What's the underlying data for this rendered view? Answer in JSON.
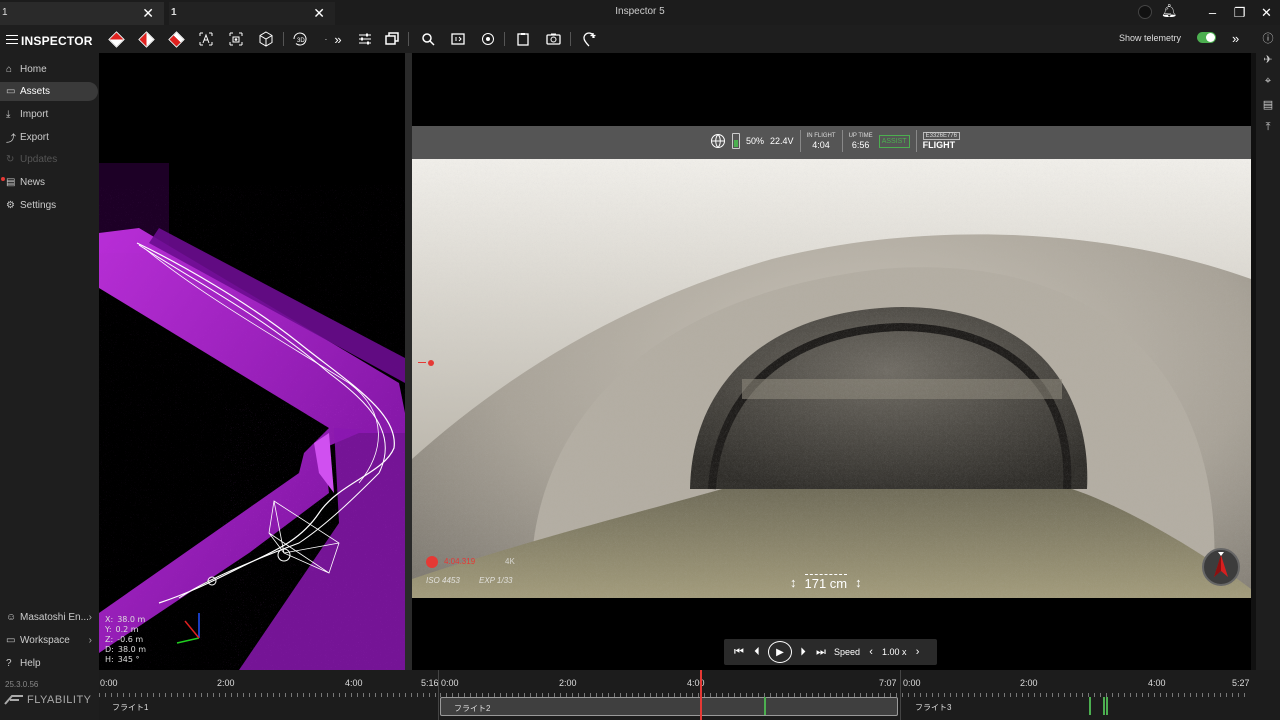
{
  "tabs": [
    {
      "label": "1",
      "close": "✕"
    },
    {
      "label": "1",
      "close": "✕"
    }
  ],
  "window": {
    "title": "Inspector 5",
    "minimize": "–",
    "restore": "❐",
    "close": "✕"
  },
  "toolbar": {
    "app_title": "INSPECTOR",
    "show_telemetry_label": "Show telemetry",
    "telemetry_on": true,
    "tool_3d_label": "3D"
  },
  "sidebar": {
    "items": [
      {
        "label": "Home",
        "icon": "home-icon"
      },
      {
        "label": "Assets",
        "icon": "folder-icon"
      },
      {
        "label": "Import",
        "icon": "download-icon"
      },
      {
        "label": "Export",
        "icon": "share-icon"
      },
      {
        "label": "Updates",
        "icon": "refresh-icon"
      },
      {
        "label": "News",
        "icon": "news-icon"
      },
      {
        "label": "Settings",
        "icon": "gear-icon"
      }
    ],
    "bottom": [
      {
        "label": "Masatoshi En...",
        "icon": "user-icon"
      },
      {
        "label": "Workspace",
        "icon": "folder-icon"
      },
      {
        "label": "Help",
        "icon": "help-icon"
      }
    ],
    "version": "25.3.0.56",
    "brand": "FLYABILITY"
  },
  "coords": {
    "x_label": "X:",
    "x": "38.0 m",
    "y_label": "Y:",
    "y": "0.2 m",
    "z_label": "Z:",
    "z": "-0.6 m",
    "d_label": "D:",
    "d": "38.0 m",
    "h_label": "H:",
    "h": "345 °"
  },
  "hud": {
    "battery_pct": "50%",
    "voltage": "22.4V",
    "in_flight_label": "IN FLIGHT",
    "in_flight": "4:04",
    "up_time_label": "UP TIME",
    "up_time": "6:56",
    "assist": "ASSIST",
    "flight_box": "E3326E776",
    "flight_mode": "FLIGHT"
  },
  "video": {
    "rec_time": "4:04.319",
    "resolution": "4K",
    "iso": "ISO 4453",
    "exp": "EXP 1/33",
    "distance": "171 cm"
  },
  "playback": {
    "speed_label": "Speed",
    "speed_value": "1.00 x"
  },
  "timeline": {
    "segments": [
      {
        "name": "フライト1",
        "ticks": [
          "0:00",
          "2:00",
          "4:00",
          "5:16"
        ],
        "active": false
      },
      {
        "name": "フライト2",
        "ticks": [
          "0:00",
          "2:00",
          "4:00",
          "7:07"
        ],
        "active": true
      },
      {
        "name": "フライト3",
        "ticks": [
          "0:00",
          "2:00",
          "4:00",
          "5:27"
        ],
        "active": false
      }
    ]
  },
  "colors": {
    "accent_green": "#4caf50",
    "record_red": "#e53935",
    "pointcloud_purple": "#a020c8"
  }
}
